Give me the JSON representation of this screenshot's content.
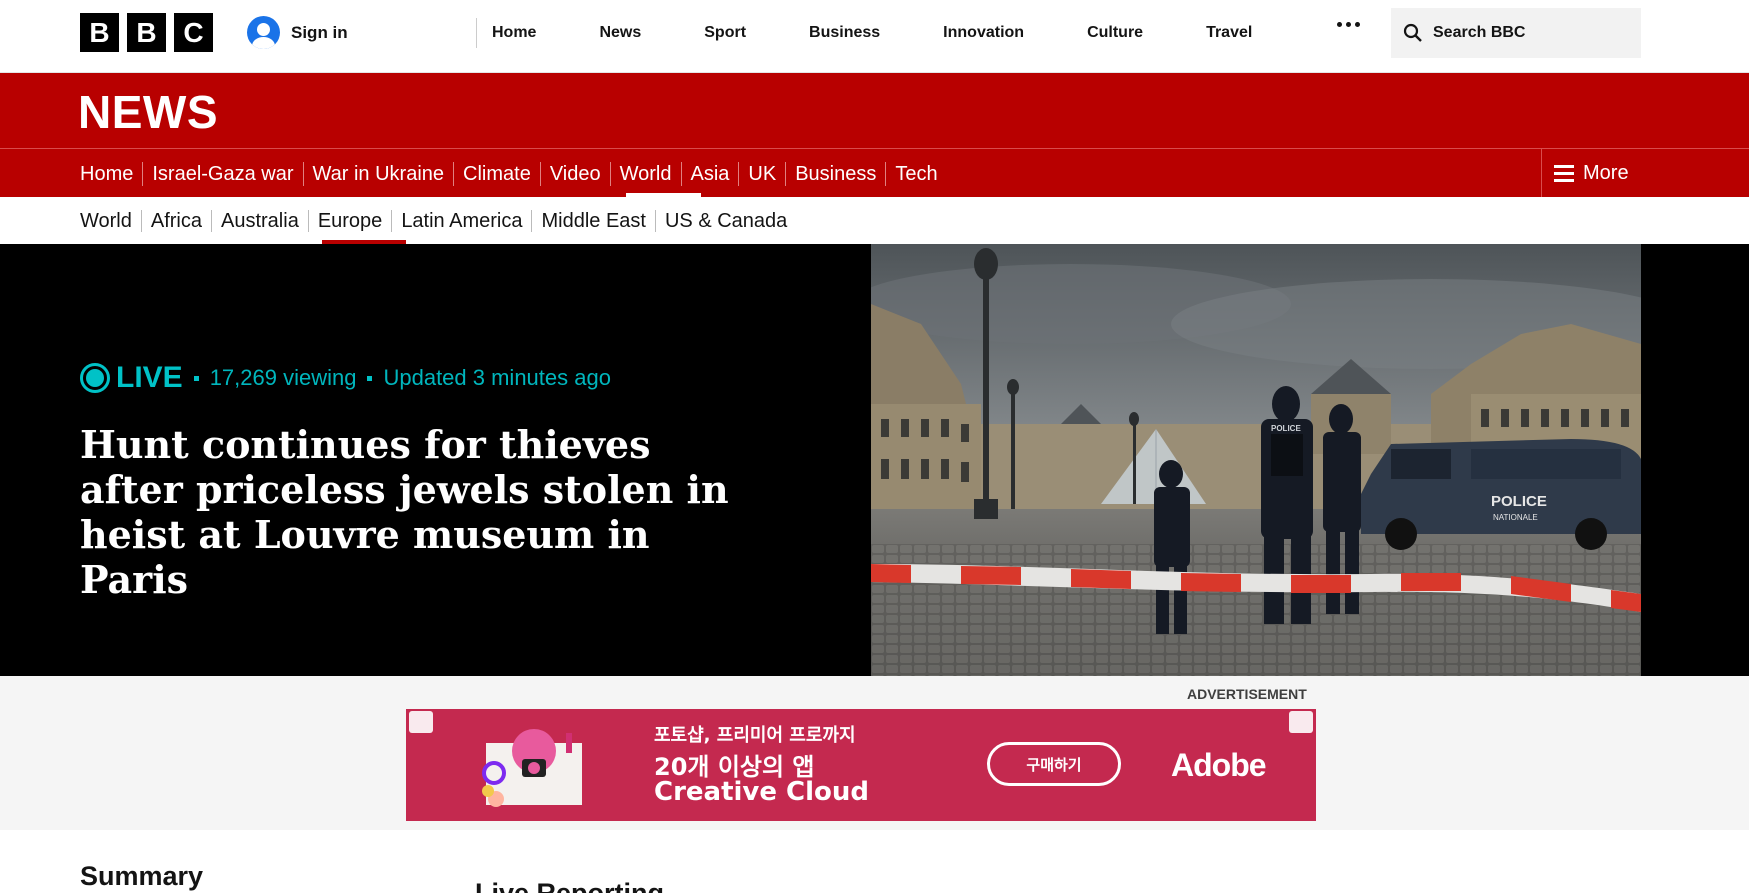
{
  "bbc": {
    "logo_letters": [
      "B",
      "B",
      "C"
    ],
    "sign_in": "Sign in",
    "nav": [
      "Home",
      "News",
      "Sport",
      "Business",
      "Innovation",
      "Culture",
      "Travel"
    ],
    "search_placeholder": "Search BBC"
  },
  "news": {
    "title": "NEWS",
    "sections": [
      {
        "label": "Home"
      },
      {
        "label": "Israel-Gaza war"
      },
      {
        "label": "War in Ukraine"
      },
      {
        "label": "Climate"
      },
      {
        "label": "Video"
      },
      {
        "label": "World",
        "active": true
      },
      {
        "label": "Asia"
      },
      {
        "label": "UK"
      },
      {
        "label": "Business"
      },
      {
        "label": "Tech"
      }
    ],
    "more_label": "More",
    "subsections": [
      {
        "label": "World"
      },
      {
        "label": "Africa"
      },
      {
        "label": "Australia"
      },
      {
        "label": "Europe",
        "active": true
      },
      {
        "label": "Latin America"
      },
      {
        "label": "Middle East"
      },
      {
        "label": "US & Canada"
      }
    ]
  },
  "hero": {
    "live_label": "LIVE",
    "viewing": "17,269 viewing",
    "updated": "Updated 3 minutes ago",
    "headline": "Hunt continues for thieves after priceless jewels stolen in heist at Louvre museum in Paris",
    "van_text": "POLICE NATIONALE",
    "vest_text": "POLICE"
  },
  "ad": {
    "label": "ADVERTISEMENT",
    "line1": "포토샵, 프리미어 프로까지",
    "line2": "20개 이상의 앱",
    "line3": "Creative Cloud",
    "button": "구매하기",
    "brand": "Adobe"
  },
  "below": {
    "summary": "Summary",
    "live_reporting": "Live Reporting"
  },
  "colors": {
    "bbc_red": "#b80000",
    "live_teal": "#00c2c7",
    "ad_bg": "#c4294f"
  }
}
